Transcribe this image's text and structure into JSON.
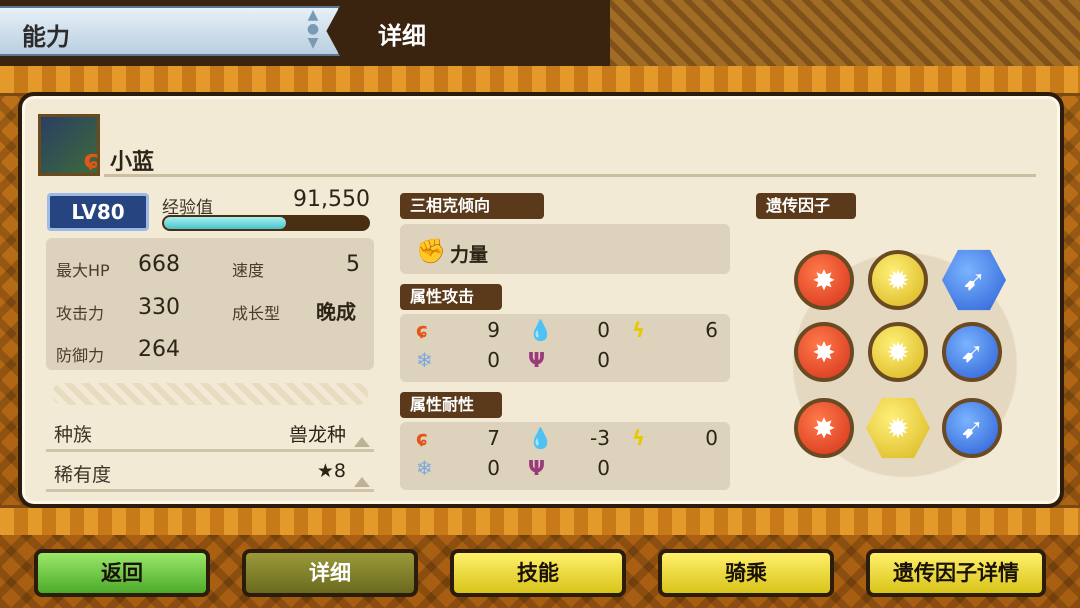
{
  "header": {
    "tab_ability": "能力",
    "title": "详细"
  },
  "monster": {
    "name": "小蓝",
    "icon": "nargacuga-icon",
    "element_badge": "fire-icon"
  },
  "level": {
    "label": "LV80"
  },
  "exp": {
    "label": "经验值",
    "value": "91,550",
    "progress_fraction": 0.6
  },
  "stats": {
    "max_hp_label": "最大HP",
    "max_hp": "668",
    "speed_label": "速度",
    "speed": "5",
    "attack_label": "攻击力",
    "attack": "330",
    "growth_label": "成长型",
    "growth": "晚成",
    "defense_label": "防御力",
    "defense": "264"
  },
  "info": {
    "race_label": "种族",
    "race": "兽龙种",
    "rarity_label": "稀有度",
    "rarity": "★8"
  },
  "tendency": {
    "header": "三相克倾向",
    "value": "力量",
    "icon": "power-icon"
  },
  "attr_attack": {
    "header": "属性攻击",
    "fire": "9",
    "water": "0",
    "thunder": "6",
    "ice": "0",
    "dragon": "0"
  },
  "attr_resist": {
    "header": "属性耐性",
    "fire": "7",
    "water": "-3",
    "thunder": "0",
    "ice": "0",
    "dragon": "0"
  },
  "genes": {
    "header": "遗传因子",
    "items": [
      {
        "color": "red",
        "icon": "power-gene-icon"
      },
      {
        "color": "yellow",
        "icon": "technical-gene-icon"
      },
      {
        "color": "blue",
        "icon": "speed-gene-icon"
      },
      {
        "color": "red",
        "icon": "power-gene-icon"
      },
      {
        "color": "yellow",
        "icon": "technical-gene-icon"
      },
      {
        "color": "blue",
        "icon": "speed-gene-icon"
      },
      {
        "color": "red",
        "icon": "power-gene-icon"
      },
      {
        "color": "yellow",
        "icon": "technical-gene-icon"
      },
      {
        "color": "blue",
        "icon": "speed-gene-icon"
      }
    ]
  },
  "buttons": {
    "back": "返回",
    "detail": "详细",
    "skill": "技能",
    "ride": "骑乘",
    "gene_detail": "遗传因子详情"
  },
  "colors": {
    "panel": "#f3ead6",
    "header_bg": "#5a3a1a",
    "exp_fill": "#49c2c8"
  }
}
